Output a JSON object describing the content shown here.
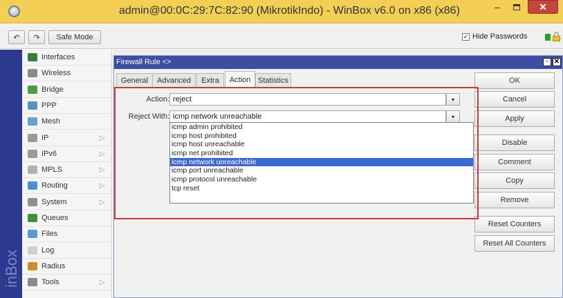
{
  "window": {
    "title": "admin@00:0C:29:7C:82:90 (MikrotikIndo) - WinBox v6.0 on x86 (x86)",
    "minimize_glyph": "–",
    "close_glyph": "✕"
  },
  "toolbar": {
    "undo_glyph": "↶",
    "redo_glyph": "↷",
    "safe_mode_label": "Safe Mode",
    "hide_passwords_label": "Hide Passwords",
    "hide_passwords_checked_glyph": "✓"
  },
  "brand": {
    "text": "inBox"
  },
  "sidebar": {
    "items": [
      {
        "label": "Interfaces",
        "icon": "interfaces-icon",
        "color": "#3a7d3a",
        "arrow": ""
      },
      {
        "label": "Wireless",
        "icon": "wireless-icon",
        "color": "#8a8a8a",
        "arrow": ""
      },
      {
        "label": "Bridge",
        "icon": "bridge-icon",
        "color": "#4a9b4a",
        "arrow": ""
      },
      {
        "label": "PPP",
        "icon": "ppp-icon",
        "color": "#5a8fbf",
        "arrow": ""
      },
      {
        "label": "Mesh",
        "icon": "mesh-icon",
        "color": "#6aa0d0",
        "arrow": ""
      },
      {
        "label": "IP",
        "icon": "ip-icon",
        "color": "#9a9a9a",
        "arrow": "▷"
      },
      {
        "label": "IPv6",
        "icon": "ipv6-icon",
        "color": "#9a9a9a",
        "arrow": "▷"
      },
      {
        "label": "MPLS",
        "icon": "mpls-icon",
        "color": "#b0b0b0",
        "arrow": "▷"
      },
      {
        "label": "Routing",
        "icon": "routing-icon",
        "color": "#4a90d9",
        "arrow": "▷"
      },
      {
        "label": "System",
        "icon": "system-icon",
        "color": "#8f8f8f",
        "arrow": "▷"
      },
      {
        "label": "Queues",
        "icon": "queues-icon",
        "color": "#3f8f3f",
        "arrow": ""
      },
      {
        "label": "Files",
        "icon": "files-icon",
        "color": "#5b9bd5",
        "arrow": ""
      },
      {
        "label": "Log",
        "icon": "log-icon",
        "color": "#d0d0d0",
        "arrow": ""
      },
      {
        "label": "Radius",
        "icon": "radius-icon",
        "color": "#d08a30",
        "arrow": ""
      },
      {
        "label": "Tools",
        "icon": "tools-icon",
        "color": "#8a8a8a",
        "arrow": "▷"
      }
    ]
  },
  "dialog": {
    "title": "Firewall Rule <>",
    "restore_glyph": "▫",
    "close_glyph": "✕",
    "tabs": [
      {
        "label": "General",
        "active": false
      },
      {
        "label": "Advanced",
        "active": false
      },
      {
        "label": "Extra",
        "active": false
      },
      {
        "label": "Action",
        "active": true
      },
      {
        "label": "Statistics",
        "active": false
      }
    ],
    "action_label": "Action:",
    "action_value": "reject",
    "reject_with_label": "Reject With:",
    "reject_with_value": "icmp network unreachable",
    "dropdown_glyph": "▾",
    "reject_options": [
      "icmp admin prohibited",
      "icmp host prohibited",
      "icmp host unreachable",
      "icmp net prohibited",
      "icmp network unreachable",
      "icmp port unreachable",
      "icmp protocol unreachable",
      "tcp reset"
    ],
    "selected_option": "icmp network unreachable",
    "highlight_color": "#c8383c",
    "buttons": [
      {
        "label": "OK",
        "name": "ok-button"
      },
      {
        "label": "Cancel",
        "name": "cancel-button"
      },
      {
        "label": "Apply",
        "name": "apply-button"
      },
      {
        "label": "Disable",
        "name": "disable-button"
      },
      {
        "label": "Comment",
        "name": "comment-button"
      },
      {
        "label": "Copy",
        "name": "copy-button"
      },
      {
        "label": "Remove",
        "name": "remove-button"
      },
      {
        "label": "Reset Counters",
        "name": "reset-counters-button"
      },
      {
        "label": "Reset All Counters",
        "name": "reset-all-counters-button"
      }
    ]
  }
}
